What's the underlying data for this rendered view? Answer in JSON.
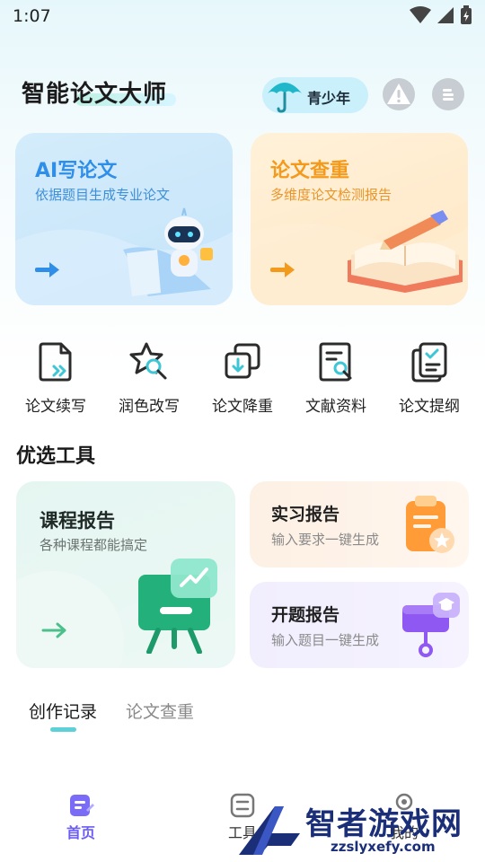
{
  "status_bar": {
    "time": "1:07"
  },
  "header": {
    "title": "智能论文大师",
    "youth_label": "青少年"
  },
  "feature_cards": [
    {
      "title": "AI写论文",
      "subtitle": "依据题目生成专业论文",
      "title_color": "#2f8fe8",
      "subtitle_color": "#3f8fd8"
    },
    {
      "title": "论文查重",
      "subtitle": "多维度论文检测报告",
      "title_color": "#f39a1c",
      "subtitle_color": "#e8962a"
    }
  ],
  "quick_actions": [
    {
      "label": "论文续写",
      "icon": "document-forward-icon"
    },
    {
      "label": "润色改写",
      "icon": "polish-search-icon"
    },
    {
      "label": "论文降重",
      "icon": "copy-download-icon"
    },
    {
      "label": "文献资料",
      "icon": "document-search-icon"
    },
    {
      "label": "论文提纲",
      "icon": "checklist-icon"
    }
  ],
  "section": {
    "title": "优选工具"
  },
  "tools": {
    "course": {
      "title": "课程报告",
      "subtitle": "各种课程都能搞定"
    },
    "internship": {
      "title": "实习报告",
      "subtitle": "输入要求一键生成"
    },
    "proposal": {
      "title": "开题报告",
      "subtitle": "输入题目一键生成"
    }
  },
  "tabs": [
    {
      "label": "创作记录",
      "active": true
    },
    {
      "label": "论文查重",
      "active": false
    }
  ],
  "bottom_nav": [
    {
      "label": "首页",
      "active": true
    },
    {
      "label": "工具",
      "active": false
    },
    {
      "label": "我的",
      "active": false
    }
  ],
  "watermark": {
    "title": "智者游戏网",
    "url": "zzslyxefy.com"
  },
  "colors": {
    "accent": "#6b5cf5",
    "tab_indicator": "#5ed0d8",
    "ai_blue": "#2f8fe8",
    "check_orange": "#f39a1c"
  }
}
